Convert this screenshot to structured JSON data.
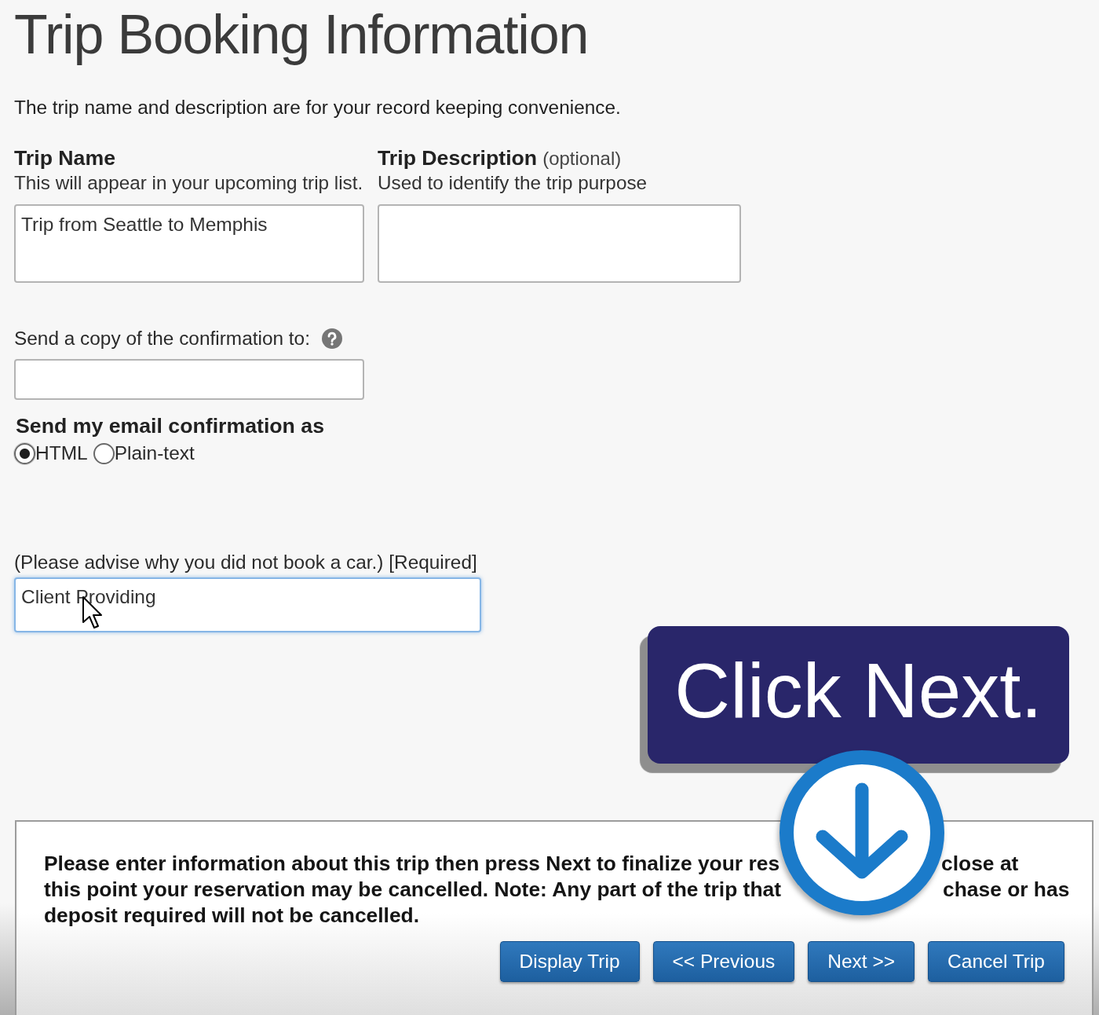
{
  "page": {
    "title": "Trip Booking Information",
    "intro": "The trip name and description are for your record keeping convenience."
  },
  "trip_name": {
    "label": "Trip Name",
    "hint": "This will appear in your upcoming trip list.",
    "value": "Trip from Seattle to Memphis"
  },
  "trip_description": {
    "label": "Trip Description",
    "label_note": "(optional)",
    "hint": "Used to identify the trip purpose"
  },
  "copy_to": {
    "label": "Send a copy of the confirmation to:"
  },
  "email_format": {
    "label": "Send my email confirmation as",
    "options": [
      {
        "label": "HTML",
        "selected": true
      },
      {
        "label": "Plain-text",
        "selected": false
      }
    ]
  },
  "car_reason": {
    "label": "(Please advise why you did not book a car.) [Required]",
    "value": "Client Providing",
    "focused": true
  },
  "callout": {
    "text": "Click Next."
  },
  "notice": {
    "lines": [
      {
        "segments": [
          "Please enter information about this trip then press Next to finalize your res",
          "close at"
        ]
      },
      {
        "segments": [
          "this point your reservation may be cancelled. Note: Any part of the trip that",
          "chase or has"
        ]
      },
      {
        "segments": [
          "deposit required will not be cancelled."
        ]
      }
    ]
  },
  "buttons": [
    {
      "label": "Display Trip"
    },
    {
      "label": "<< Previous"
    },
    {
      "label": "Next >>"
    },
    {
      "label": "Cancel Trip"
    }
  ]
}
